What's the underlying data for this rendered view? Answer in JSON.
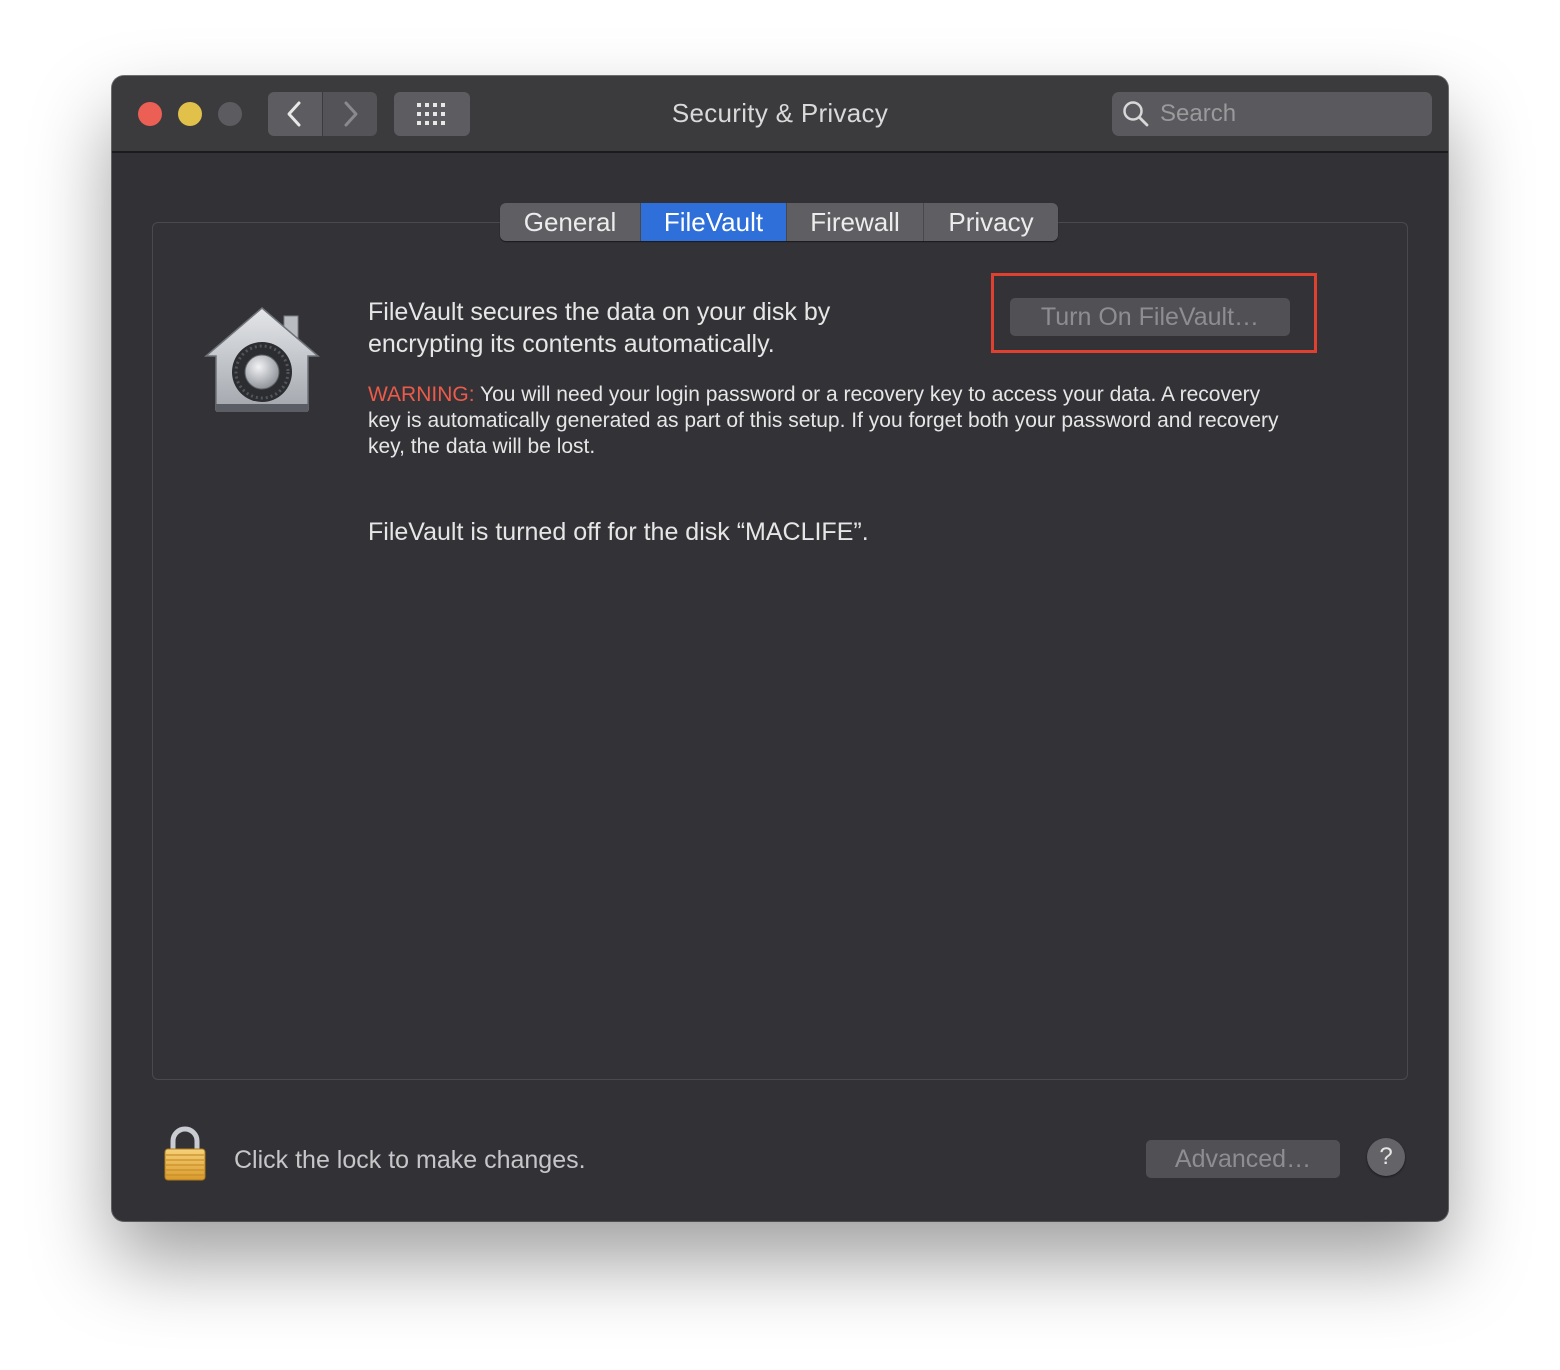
{
  "window": {
    "title": "Security & Privacy"
  },
  "toolbar": {
    "back_icon": "chevron-left-icon",
    "forward_icon": "chevron-right-icon",
    "grid_icon": "grid-icon"
  },
  "search": {
    "placeholder": "Search",
    "value": "",
    "icon": "search-icon"
  },
  "tabs": [
    {
      "label": "General",
      "selected": false
    },
    {
      "label": "FileVault",
      "selected": true
    },
    {
      "label": "Firewall",
      "selected": false
    },
    {
      "label": "Privacy",
      "selected": false
    }
  ],
  "filevault": {
    "icon": "filevault-house-vault-icon",
    "description": "FileVault secures the data on your disk by encrypting its contents automatically.",
    "turn_on_label": "Turn On FileVault…",
    "warning_label": "WARNING:",
    "warning_text": "You will need your login password or a recovery key to access your data. A recovery key is automatically generated as part of this setup. If you forget both your password and recovery key, the data will be lost.",
    "status": "FileVault is turned off for the disk “MACLIFE”."
  },
  "footer": {
    "lock_icon": "lock-icon",
    "lock_text": "Click the lock to make changes.",
    "advanced_label": "Advanced…",
    "help_label": "?"
  },
  "colors": {
    "accent": "#2f6fd9",
    "warning": "#ec5a4b",
    "highlight_frame": "#e0402f",
    "window_bg": "#323236"
  }
}
